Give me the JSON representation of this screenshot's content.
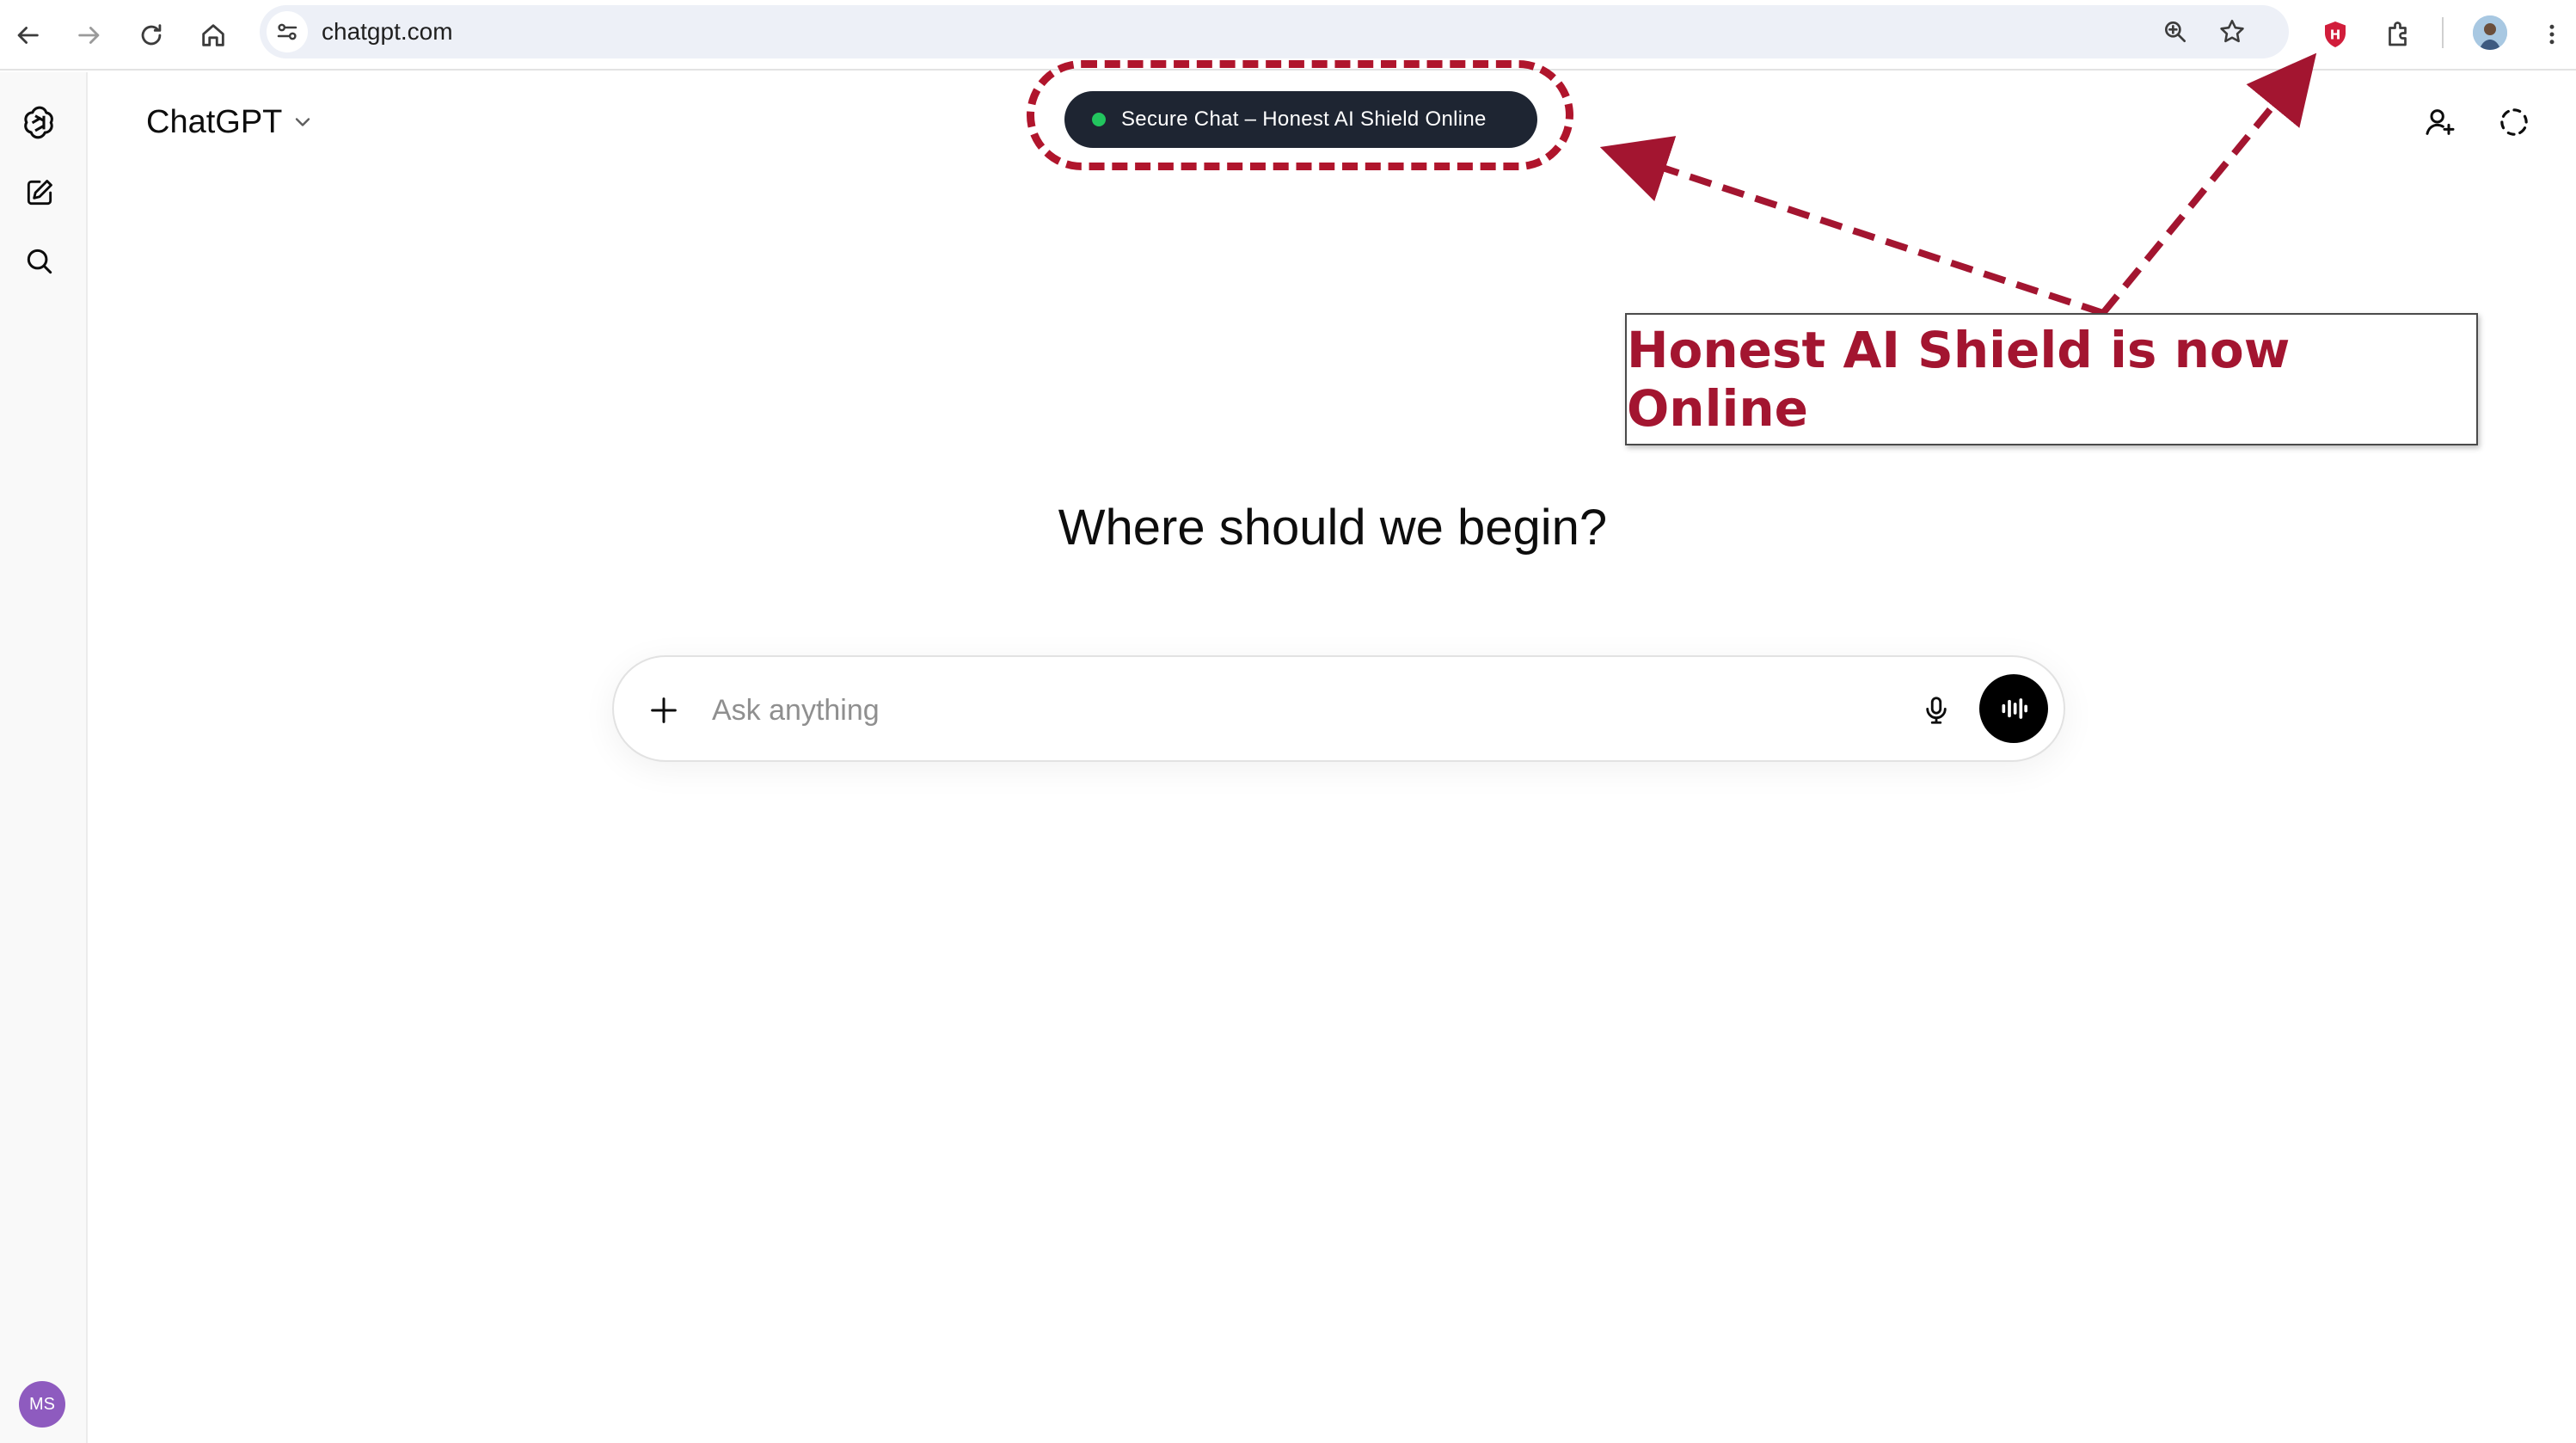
{
  "browser": {
    "url": "chatgpt.com",
    "icons": {
      "back": "back-arrow-icon",
      "forward": "forward-arrow-icon",
      "reload": "reload-icon",
      "home": "home-icon",
      "site_info": "tune-icon",
      "zoom": "zoom-icon",
      "bookmark": "star-icon",
      "extension": "honest-ai-shield-extension-icon",
      "extensions_menu": "puzzle-icon",
      "menu": "kebab-menu-icon"
    }
  },
  "sidebar": {
    "user_initials": "MS",
    "avatar_color": "#8e5bbf",
    "icons": [
      "openai-logo-icon",
      "new-chat-icon",
      "search-icon"
    ]
  },
  "header": {
    "model_name": "ChatGPT",
    "secure_status": "Secure Chat – Honest AI Shield Online",
    "status_color": "#22c55e"
  },
  "annotation": {
    "text": "Honest AI Shield is now Online",
    "color": "#a31530"
  },
  "main": {
    "heading": "Where should we begin?",
    "composer": {
      "placeholder": "Ask anything"
    }
  }
}
